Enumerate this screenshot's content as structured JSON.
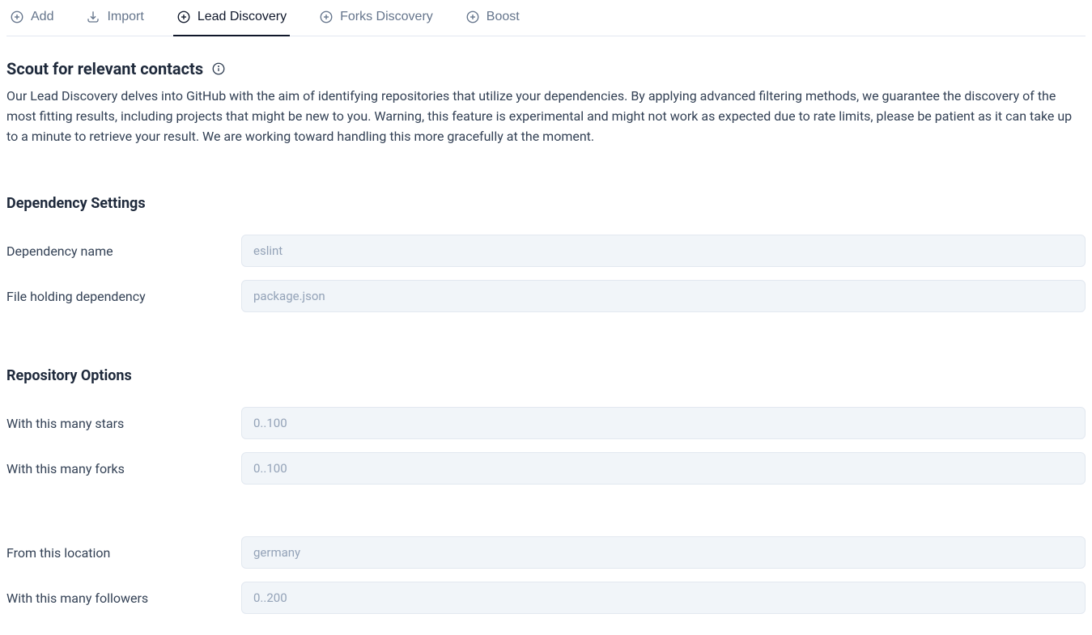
{
  "tabs": {
    "add": "Add",
    "import": "Import",
    "lead_discovery": "Lead Discovery",
    "forks_discovery": "Forks Discovery",
    "boost": "Boost"
  },
  "header": {
    "title": "Scout for relevant contacts",
    "description": "Our Lead Discovery delves into GitHub with the aim of identifying repositories that utilize your dependencies. By applying advanced filtering methods, we guarantee the discovery of the most fitting results, including projects that might be new to you. Warning, this feature is experimental and might not work as expected due to rate limits, please be patient as it can take up to a minute to retrieve your result. We are working toward handling this more gracefully at the moment."
  },
  "dependency": {
    "section_title": "Dependency Settings",
    "name_label": "Dependency name",
    "name_placeholder": "eslint",
    "file_label": "File holding dependency",
    "file_placeholder": "package.json"
  },
  "repo": {
    "section_title": "Repository Options",
    "stars_label": "With this many stars",
    "stars_placeholder": "0..100",
    "forks_label": "With this many forks",
    "forks_placeholder": "0..100",
    "location_label": "From this location",
    "location_placeholder": "germany",
    "followers_label": "With this many followers",
    "followers_placeholder": "0..200"
  }
}
